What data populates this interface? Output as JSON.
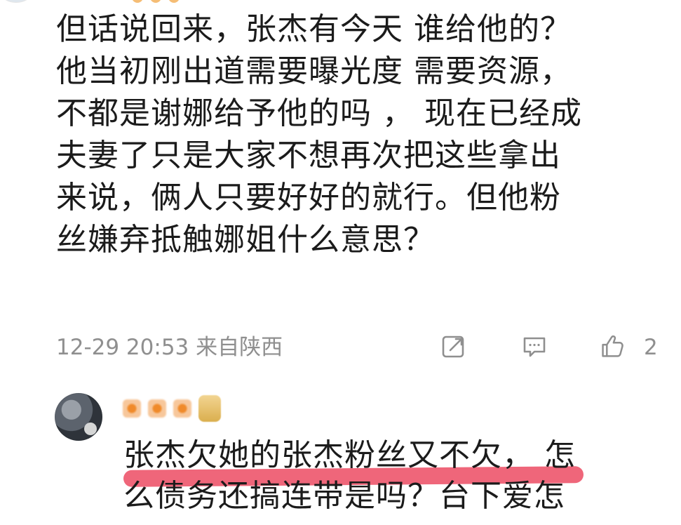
{
  "comment": {
    "lines": [
      "但话说回来，张杰有今天 谁给他的？",
      "他当初刚出道需要曝光度 需要资源，",
      "不都是谢娜给予他的吗 ， 现在已经成",
      "夫妻了只是大家不想再次把这些拿出",
      "来说，俩人只要好好的就行。但他粉",
      "丝嫌弃抵触娜姐什么意思？"
    ],
    "timestamp": "12-29 20:53",
    "location": "来自陕西",
    "like_count": "2"
  },
  "actions": {
    "share_icon": "share-icon",
    "comment_icon": "comment-icon",
    "like_icon": "like-icon"
  },
  "reply": {
    "lines": [
      "张杰欠她的张杰粉丝又不欠， 怎",
      "么债务还搞连带是吗？台下爱怎"
    ]
  },
  "colors": {
    "text": "#1b1b1b",
    "meta": "#8f8f8f",
    "highlight": "#ea3b55"
  }
}
